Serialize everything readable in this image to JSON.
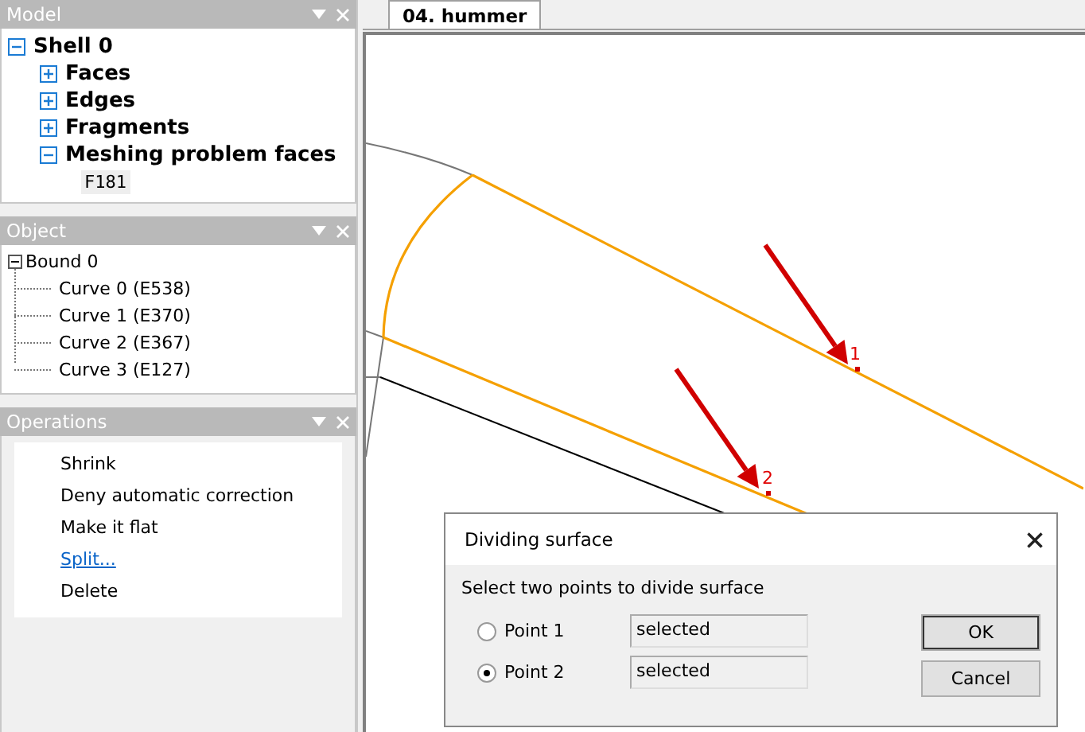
{
  "panels": [
    {
      "title": "Model",
      "kind": "model",
      "tree": [
        {
          "label": "Shell 0",
          "expanded": true,
          "children": [
            {
              "label": "Faces",
              "expanded": false
            },
            {
              "label": "Edges",
              "expanded": false
            },
            {
              "label": "Fragments",
              "expanded": false
            },
            {
              "label": "Meshing problem faces",
              "expanded": true,
              "children": [
                {
                  "label": "F181",
                  "kind": "code"
                }
              ]
            }
          ]
        }
      ]
    },
    {
      "title": "Object",
      "kind": "object",
      "tree": [
        {
          "label": "Bound 0",
          "expanded": true,
          "children": [
            {
              "label": "Curve 0 (E538)"
            },
            {
              "label": "Curve 1 (E370)"
            },
            {
              "label": "Curve 2 (E367)"
            },
            {
              "label": "Curve 3 (E127)"
            }
          ]
        }
      ]
    },
    {
      "title": "Operations",
      "kind": "operations",
      "items": [
        {
          "label": "Shrink",
          "kind": "plain"
        },
        {
          "label": "Deny automatic correction",
          "kind": "plain"
        },
        {
          "label": "Make it flat",
          "kind": "plain"
        },
        {
          "label": "Split...",
          "kind": "link"
        },
        {
          "label": "Delete",
          "kind": "plain"
        }
      ]
    }
  ],
  "tabs": [
    {
      "label": "04. hummer",
      "selected": true
    }
  ],
  "canvas": {
    "markers": [
      {
        "label": "1"
      },
      {
        "label": "2"
      }
    ]
  },
  "dialog": {
    "title": "Dividing surface",
    "prompt": "Select two points to divide surface",
    "points": [
      {
        "label": "Point 1",
        "selected": false,
        "value": "selected"
      },
      {
        "label": "Point 2",
        "selected": true,
        "value": "selected"
      }
    ],
    "buttons": [
      "OK",
      "Cancel"
    ]
  }
}
